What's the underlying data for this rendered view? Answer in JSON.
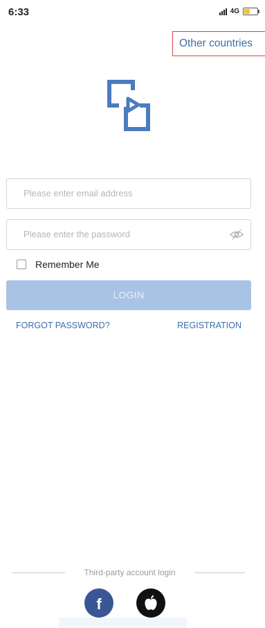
{
  "status_bar": {
    "time": "6:33",
    "network": "4G",
    "battery_level": 0.5,
    "battery_color": "#f5c518"
  },
  "header": {
    "country_link": "Other countries"
  },
  "logo": {
    "icon": "app-logo-icon",
    "color": "#4a7cc0"
  },
  "form": {
    "email_placeholder": "Please enter email address",
    "password_placeholder": "Please enter the password",
    "password_icon": "eye-slash-icon",
    "remember_label": "Remember Me",
    "remember_checked": false,
    "login_label": "LOGIN",
    "forgot_label": "FORGOT PASSWORD?",
    "register_label": "REGISTRATION"
  },
  "third_party": {
    "label": "Third-party account login",
    "providers": [
      {
        "name": "facebook",
        "icon": "facebook-icon",
        "color": "#3a5694"
      },
      {
        "name": "apple",
        "icon": "apple-icon",
        "color": "#111111"
      }
    ]
  },
  "colors": {
    "link": "#3b6ea8",
    "button_disabled": "#a9c3e4",
    "highlight_border": "#d94040"
  }
}
